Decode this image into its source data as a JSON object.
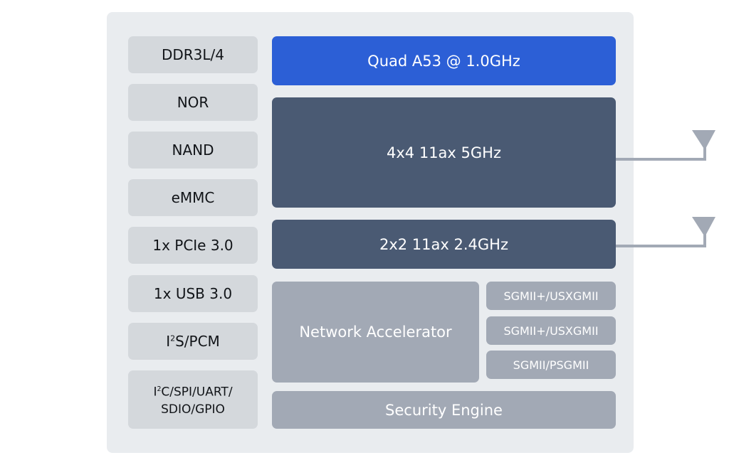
{
  "colors": {
    "panel_bg": "#e9ecef",
    "interface_box": "#d4d8dc",
    "cpu": "#2c5fd6",
    "radio": "#4a5a73",
    "block": "#a2a9b5",
    "antenna": "#a2a9b5"
  },
  "interfaces": [
    {
      "label": "DDR3L/4"
    },
    {
      "label": "NOR"
    },
    {
      "label": "NAND"
    },
    {
      "label": "eMMC"
    },
    {
      "label": "1x PCIe 3.0"
    },
    {
      "label": "1x USB 3.0"
    },
    {
      "label_pre": "I",
      "label_sup": "2",
      "label_post": "S/PCM"
    },
    {
      "line1_pre": "I",
      "line1_sup": "2",
      "line1_post": "C/SPI/UART/",
      "line2": "SDIO/GPIO"
    }
  ],
  "cpu": {
    "label": "Quad A53 @ 1.0GHz"
  },
  "radios": [
    {
      "label": "4x4 11ax 5GHz",
      "antenna_icon": "antenna-icon"
    },
    {
      "label": "2x2 11ax 2.4GHz",
      "antenna_icon": "antenna-icon"
    }
  ],
  "network_accelerator": {
    "label": "Network Accelerator"
  },
  "ethernet_ports": [
    {
      "label": "SGMII+/USXGMII"
    },
    {
      "label": "SGMII+/USXGMII"
    },
    {
      "label": "SGMII/PSGMII"
    }
  ],
  "security_engine": {
    "label": "Security Engine"
  }
}
